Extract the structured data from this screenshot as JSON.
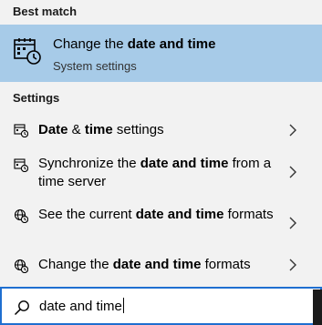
{
  "sections": {
    "best_match": "Best match",
    "settings": "Settings"
  },
  "best_match": {
    "title_pre": "Change the ",
    "title_bold": "date and time",
    "subtitle": "System settings",
    "icon": "calendar-clock-icon"
  },
  "items": [
    {
      "icon": "calendar-clock-icon",
      "parts": [
        [
          "b",
          "Date"
        ],
        [
          "n",
          " & "
        ],
        [
          "b",
          "time"
        ],
        [
          "n",
          " settings"
        ]
      ]
    },
    {
      "icon": "calendar-clock-icon",
      "parts": [
        [
          "n",
          "Synchronize the "
        ],
        [
          "b",
          "date and time"
        ],
        [
          "n",
          " from a time server"
        ]
      ]
    },
    {
      "icon": "globe-clock-icon",
      "parts": [
        [
          "n",
          "See the current "
        ],
        [
          "b",
          "date and time"
        ],
        [
          "n",
          " formats"
        ]
      ]
    },
    {
      "icon": "globe-clock-icon",
      "parts": [
        [
          "n",
          "Change the "
        ],
        [
          "b",
          "date and time"
        ],
        [
          "n",
          " formats"
        ]
      ]
    }
  ],
  "search": {
    "value": "date and time",
    "icon": "search-icon"
  },
  "colors": {
    "highlight": "#a7cbe8",
    "background": "#f2f2f2",
    "search_border": "#1f6fd0"
  }
}
